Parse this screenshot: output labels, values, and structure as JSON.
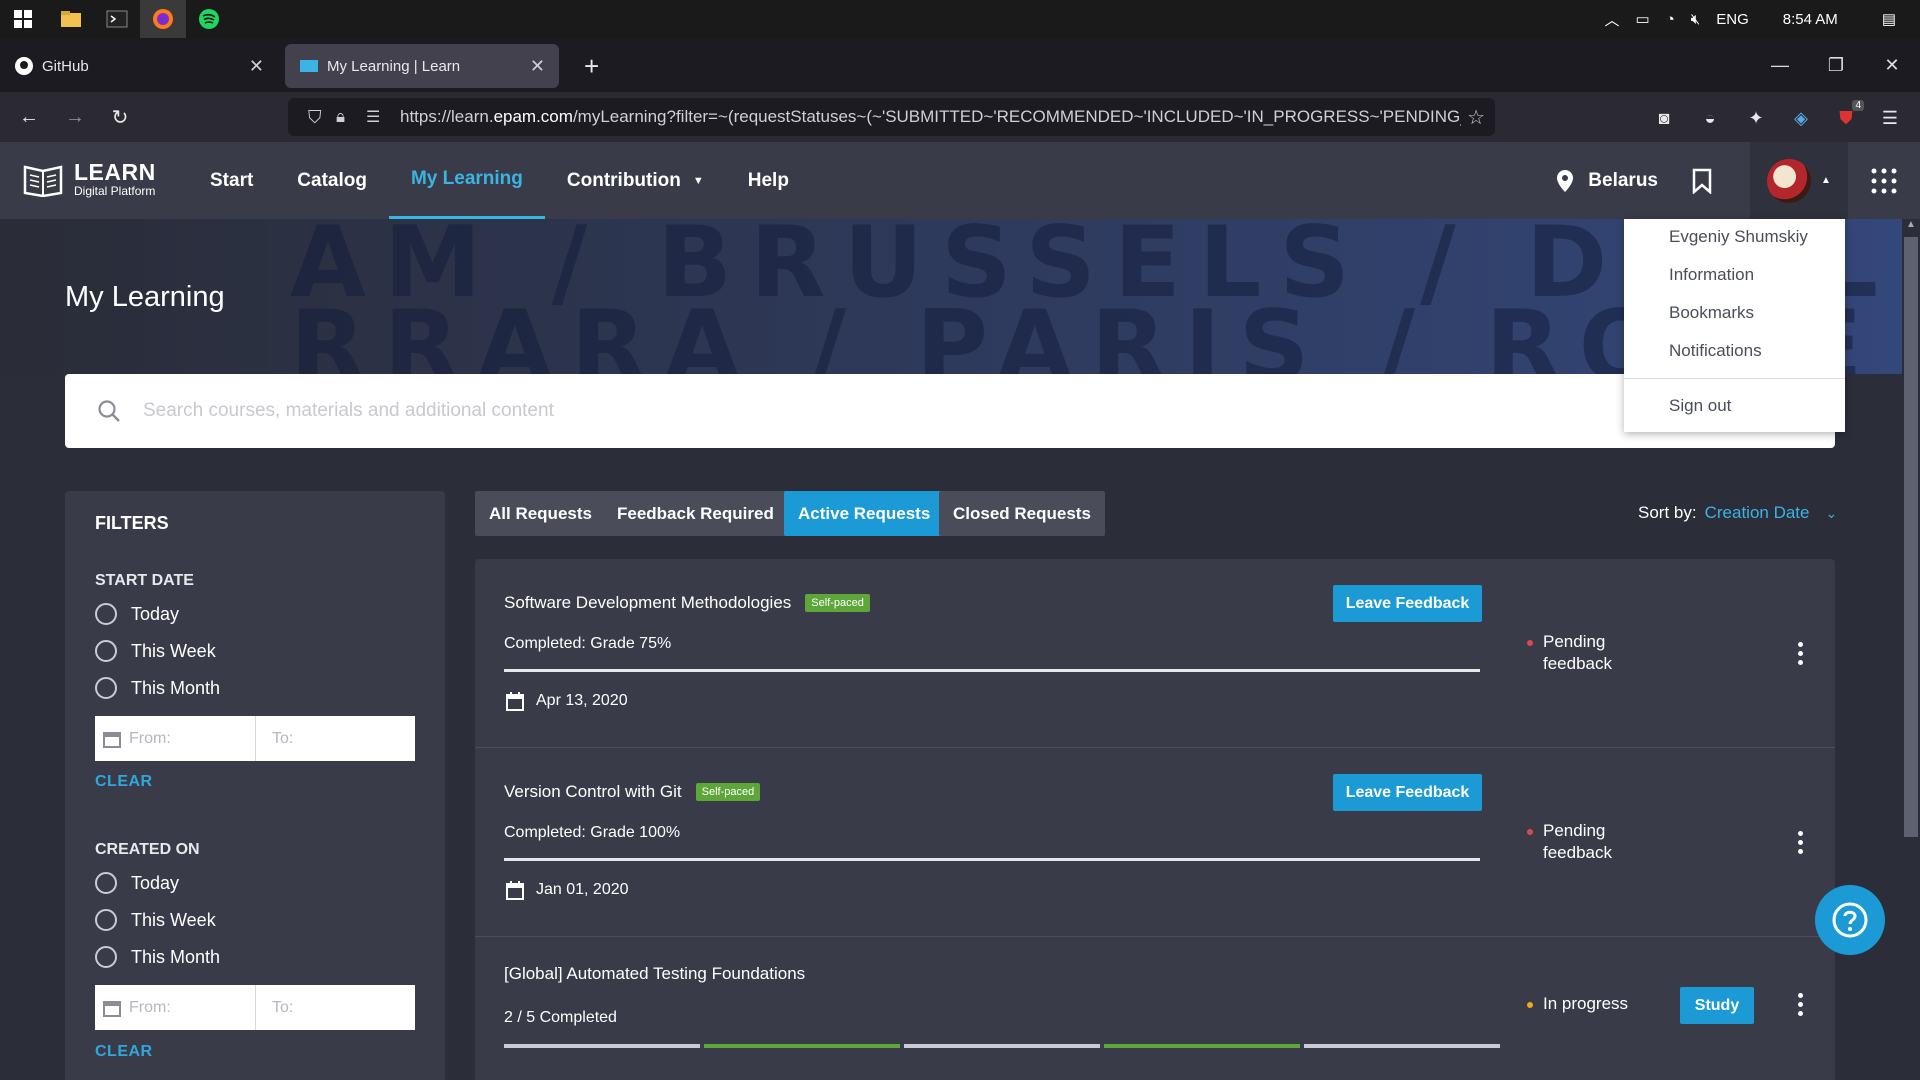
{
  "taskbar": {
    "apps": [
      "windows-start",
      "file-explorer",
      "terminal",
      "firefox",
      "spotify"
    ],
    "tray": {
      "language": "ENG",
      "time": "8:54 AM"
    }
  },
  "browser": {
    "tabs": [
      {
        "title": "GitHub",
        "icon": "github-icon"
      },
      {
        "title": "My Learning | Learn",
        "icon": "learn-icon"
      }
    ],
    "url_prefix": "https://learn.",
    "url_domain": "epam.com",
    "url_rest": "/myLearning?filter=~(requestStatuses~(~'SUBMITTED~'RECOMMENDED~'INCLUDED~'IN_PROGRESS~'PENDING_F",
    "extension_badge": "4"
  },
  "header": {
    "logo_title": "LEARN",
    "logo_subtitle": "Digital Platform",
    "nav": [
      "Start",
      "Catalog",
      "My Learning",
      "Contribution",
      "Help"
    ],
    "active_nav": "My Learning",
    "location": "Belarus"
  },
  "hero": {
    "title": "My Learning",
    "cities_line1": "AM / BRUSSELS / DUBLIN / POTSDAM / B",
    "cities_line2": "RRARA / PARIS / ROME / OSLO / F"
  },
  "search": {
    "placeholder": "Search courses, materials and additional content"
  },
  "user_menu": {
    "items": [
      "Evgeniy Shumskiy",
      "Information",
      "Bookmarks",
      "Notifications"
    ],
    "sign_out": "Sign out"
  },
  "filters": {
    "title": "FILTERS",
    "start_date": {
      "label": "START DATE",
      "options": [
        "Today",
        "This Week",
        "This Month"
      ],
      "from_placeholder": "From:",
      "to_placeholder": "To:",
      "clear": "CLEAR"
    },
    "created_on": {
      "label": "CREATED ON",
      "options": [
        "Today",
        "This Week",
        "This Month"
      ],
      "from_placeholder": "From:",
      "to_placeholder": "To:",
      "clear": "CLEAR"
    }
  },
  "request_tabs": [
    "All Requests",
    "Feedback Required",
    "Active Requests",
    "Closed Requests"
  ],
  "active_request_tab": "Active Requests",
  "sort": {
    "label": "Sort by:",
    "value": "Creation Date"
  },
  "courses": [
    {
      "title": "Software Development Methodologies",
      "badge": "Self-paced",
      "grade": "Completed: Grade 75%",
      "progress": 1.0,
      "date": "Apr 13, 2020",
      "action": "Leave Feedback",
      "status_line1": "Pending",
      "status_line2": "feedback",
      "status_color": "#e0474c"
    },
    {
      "title": "Version Control with Git",
      "badge": "Self-paced",
      "grade": "Completed: Grade 100%",
      "progress": 1.0,
      "date": "Jan 01, 2020",
      "action": "Leave Feedback",
      "status_line1": "Pending",
      "status_line2": "feedback",
      "status_color": "#e0474c"
    },
    {
      "title": "[Global] Automated Testing Foundations",
      "progress_text": "2 / 5 Completed",
      "segments_completed": [
        false,
        true,
        false,
        true,
        false
      ],
      "status": "In progress",
      "status_color": "#f0a81c",
      "action": "Study"
    }
  ],
  "colors": {
    "accent": "#1b9ad6",
    "badge_green": "#5da73a",
    "segment_done": "#5da73a",
    "segment_todo": "#c9ccd4"
  }
}
